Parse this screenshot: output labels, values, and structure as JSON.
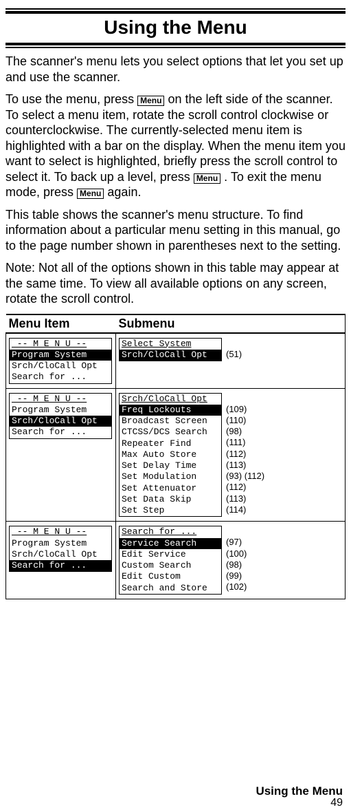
{
  "title": "Using the Menu",
  "para1": "The scanner's menu lets you select options that let you set up and use the scanner.",
  "para2a": "To use the menu, press ",
  "para2b": " on the left side of the scanner. To select a menu item, rotate the scroll control clockwise or counterclockwise. The currently-selected menu item is highlighted with a bar on the display. When the menu item you want to select is highlighted, briefly press the scroll control to select it. To back up a level, press ",
  "para2c": ". To exit the menu mode, press ",
  "para2d": " again.",
  "para3": "This table shows the scanner's menu structure. To find information about a particular menu setting in this manual, go to the page number shown in parentheses next to the setting.",
  "para4": "Note: Not all of the options shown in this table may appear at the same time. To view all available options on any screen, rotate the scroll control.",
  "menu_label": "Menu",
  "table": {
    "headers": [
      "Menu Item",
      "Submenu"
    ],
    "rows": [
      {
        "menu_lcd": {
          "header": "-- M E N U --",
          "lines": [
            {
              "text": "Program System",
              "hl": true
            },
            {
              "text": "Srch/CloCall Opt",
              "hl": false
            },
            {
              "text": "Search for ...",
              "hl": false
            }
          ]
        },
        "sub_lcd": {
          "header_under": "Select System",
          "lines": [
            {
              "text": "Srch/CloCall Opt",
              "hl": true
            }
          ]
        },
        "pages": [
          "(51)"
        ]
      },
      {
        "menu_lcd": {
          "header": "-- M E N U --",
          "lines": [
            {
              "text": "Program System",
              "hl": false
            },
            {
              "text": "Srch/CloCall Opt",
              "hl": true
            },
            {
              "text": "Search for ...",
              "hl": false
            }
          ]
        },
        "sub_lcd": {
          "header_under": "Srch/CloCall Opt",
          "lines": [
            {
              "text": "Freq Lockouts",
              "hl": true
            },
            {
              "text": "Broadcast Screen",
              "hl": false
            },
            {
              "text": "CTCSS/DCS Search",
              "hl": false
            },
            {
              "text": "Repeater Find",
              "hl": false
            },
            {
              "text": "Max Auto Store",
              "hl": false
            },
            {
              "text": "Set Delay Time",
              "hl": false
            },
            {
              "text": "Set Modulation",
              "hl": false
            },
            {
              "text": "Set Attenuator",
              "hl": false
            },
            {
              "text": "Set Data Skip",
              "hl": false
            },
            {
              "text": "Set Step",
              "hl": false
            }
          ]
        },
        "pages": [
          "(109)",
          "(110)",
          "(98)",
          "(111)",
          "(112)",
          "(113)",
          "(93) (112)",
          "(112)",
          "(113)",
          "(114)"
        ]
      },
      {
        "menu_lcd": {
          "header": "-- M E N U --",
          "lines": [
            {
              "text": "Program System",
              "hl": false
            },
            {
              "text": "Srch/CloCall Opt",
              "hl": false
            },
            {
              "text": "Search for ...",
              "hl": true
            }
          ]
        },
        "sub_lcd": {
          "header_under": "Search for ...",
          "lines": [
            {
              "text": "Service Search",
              "hl": true
            },
            {
              "text": "Edit Service",
              "hl": false
            },
            {
              "text": "Custom Search",
              "hl": false
            },
            {
              "text": "Edit Custom",
              "hl": false
            },
            {
              "text": "Search and Store",
              "hl": false
            }
          ]
        },
        "pages": [
          "(97)",
          "(100)",
          "(98)",
          "(99)",
          "(102)"
        ]
      }
    ]
  },
  "footer": "Using the Menu",
  "page_number": "49"
}
